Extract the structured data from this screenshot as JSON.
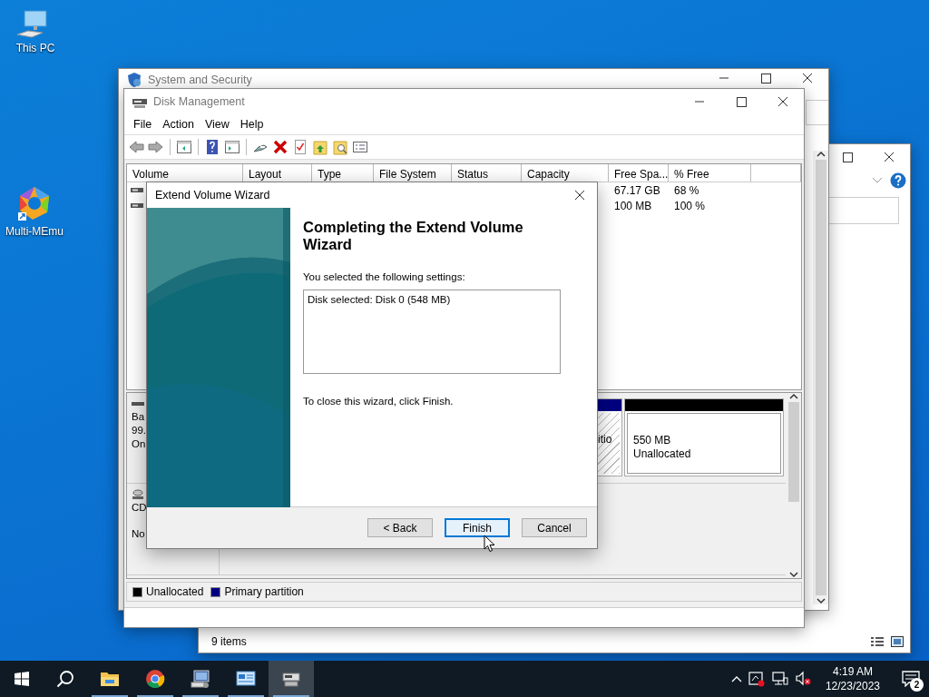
{
  "desktop_icons": [
    {
      "kind": "computer",
      "label": "This PC"
    },
    {
      "kind": "memu",
      "label": "Multi-MEmu"
    }
  ],
  "control_panel_window": {
    "title": "System and Security"
  },
  "explorer_window": {
    "status": "9 items"
  },
  "disk_management": {
    "title": "Disk Management",
    "menu": [
      "File",
      "Action",
      "View",
      "Help"
    ],
    "columns": [
      "Volume",
      "Layout",
      "Type",
      "File System",
      "Status",
      "Capacity",
      "Free Spa...",
      "% Free"
    ],
    "rows": [
      {
        "free_space": "67.17 GB",
        "percent_free": "68 %"
      },
      {
        "free_space": "100 MB",
        "percent_free": "100 %"
      }
    ],
    "disks": [
      {
        "kind": "disk",
        "label_lines": [
          "Ba",
          "99.",
          "On"
        ],
        "partitions": [
          {
            "kind": "primary",
            "lines": [
              "itio"
            ]
          },
          {
            "kind": "unallocated",
            "lines": [
              "550 MB",
              "Unallocated"
            ]
          }
        ]
      },
      {
        "kind": "cdrom",
        "label_lines": [
          "CD",
          "No"
        ]
      }
    ],
    "legend": [
      {
        "label": "Unallocated",
        "color": "#000000"
      },
      {
        "label": "Primary partition",
        "color": "#000080"
      }
    ]
  },
  "wizard": {
    "title": "Extend Volume Wizard",
    "heading": "Completing the Extend Volume Wizard",
    "intro": "You selected the following settings:",
    "settings": "Disk selected: Disk 0 (548 MB)",
    "closing": "To close this wizard, click Finish.",
    "buttons": [
      {
        "label": "< Back",
        "focused": false
      },
      {
        "label": "Finish",
        "focused": true
      },
      {
        "label": "Cancel",
        "focused": false
      }
    ]
  },
  "taskbar": {
    "apps": [
      {
        "kind": "explorer",
        "selected": false
      },
      {
        "kind": "chrome",
        "selected": false
      },
      {
        "kind": "computer",
        "selected": false
      },
      {
        "kind": "panel",
        "selected": false
      },
      {
        "kind": "disk",
        "selected": true
      }
    ],
    "time": "4:19 AM",
    "date": "12/23/2023",
    "notifications": "2"
  }
}
